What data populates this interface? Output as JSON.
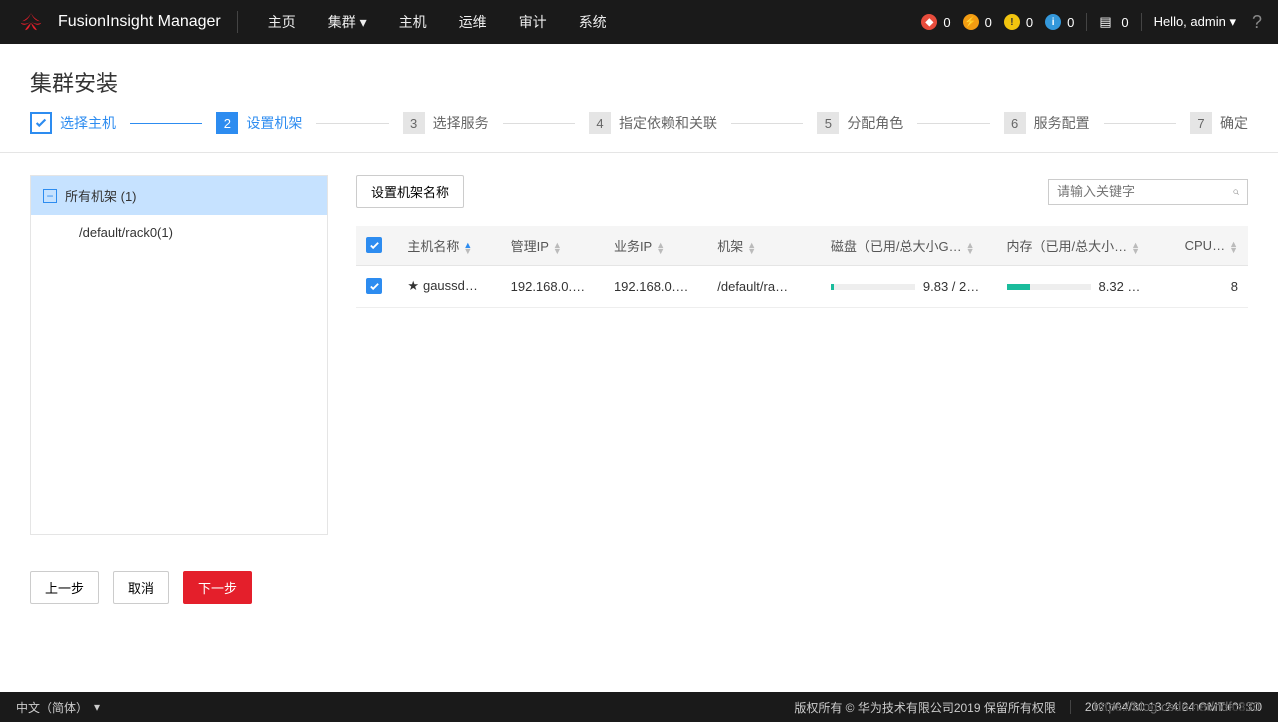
{
  "header": {
    "product": "FusionInsight Manager",
    "nav": [
      "主页",
      "集群",
      "主机",
      "运维",
      "审计",
      "系统"
    ],
    "status_counts": [
      "0",
      "0",
      "0",
      "0",
      "0"
    ],
    "user_greeting": "Hello, admin"
  },
  "page": {
    "title": "集群安装"
  },
  "wizard": {
    "steps": [
      {
        "num": "1",
        "label": "选择主机",
        "state": "done"
      },
      {
        "num": "2",
        "label": "设置机架",
        "state": "active"
      },
      {
        "num": "3",
        "label": "选择服务",
        "state": "pending"
      },
      {
        "num": "4",
        "label": "指定依赖和关联",
        "state": "pending"
      },
      {
        "num": "5",
        "label": "分配角色",
        "state": "pending"
      },
      {
        "num": "6",
        "label": "服务配置",
        "state": "pending"
      },
      {
        "num": "7",
        "label": "确定",
        "state": "pending"
      }
    ]
  },
  "sidebar": {
    "all_label": "所有机架 (1)",
    "items": [
      "/default/rack0(1)"
    ]
  },
  "toolbar": {
    "set_rack_btn": "设置机架名称",
    "search_placeholder": "请输入关键字"
  },
  "table": {
    "headers": {
      "host": "主机名称",
      "mgmt_ip": "管理IP",
      "svc_ip": "业务IP",
      "rack": "机架",
      "disk": "磁盘（已用/总大小G…",
      "mem": "内存（已用/总大小…",
      "cpu": "CPU…"
    },
    "rows": [
      {
        "host": "gaussd…",
        "mgmt_ip": "192.168.0.…",
        "svc_ip": "192.168.0.…",
        "rack": "/default/ra…",
        "disk_text": "9.83 / 2…",
        "disk_pct": 4,
        "mem_text": "8.32 …",
        "mem_pct": 28,
        "cpu": "8"
      }
    ]
  },
  "actions": {
    "prev": "上一步",
    "cancel": "取消",
    "next": "下一步"
  },
  "footer": {
    "lang": "中文（简体）",
    "copyright": "版权所有 © 华为技术有限公司2019 保留所有权限",
    "timestamp": "2020/04/30 13:24:24 GMT+08:00"
  },
  "watermark": "https://blog.csdn.net/ndfc330"
}
